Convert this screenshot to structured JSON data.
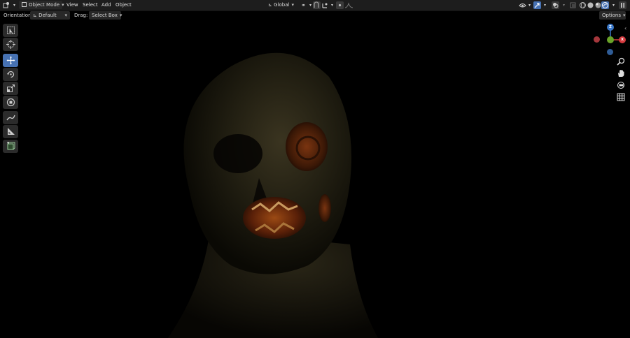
{
  "header": {
    "mode_label": "Object Mode",
    "menus": [
      "View",
      "Select",
      "Add",
      "Object"
    ],
    "transform_orientation": "Global",
    "options_label": "Options"
  },
  "tool_settings": {
    "orientation_label": "Orientation:",
    "orientation_value": "Default",
    "drag_label": "Drag:",
    "drag_value": "Select Box"
  },
  "tools": [
    {
      "name": "select-box-tool",
      "icon": "select-box-icon",
      "active": false
    },
    {
      "name": "cursor-tool",
      "icon": "cursor-icon",
      "active": false
    },
    {
      "name": "move-tool",
      "icon": "move-icon",
      "active": true
    },
    {
      "name": "rotate-tool",
      "icon": "rotate-icon",
      "active": false
    },
    {
      "name": "scale-tool",
      "icon": "scale-icon",
      "active": false
    },
    {
      "name": "transform-tool",
      "icon": "transform-icon",
      "active": false
    },
    {
      "name": "annotate-tool",
      "icon": "annotate-icon",
      "active": false
    },
    {
      "name": "measure-tool",
      "icon": "measure-icon",
      "active": false
    },
    {
      "name": "add-cube-tool",
      "icon": "add-cube-icon",
      "active": false
    }
  ],
  "gizmo": {
    "z_label": "Z",
    "x_label": "X",
    "colors": {
      "x": "#d53a3f",
      "y": "#6aa328",
      "z": "#3a78c9",
      "neg_x": "#a5373c",
      "neg_z": "#2f5c96"
    }
  },
  "colors": {
    "accent": "#4772b3",
    "header_bg": "#1d1d1d",
    "viewport_bg": "#000000"
  }
}
